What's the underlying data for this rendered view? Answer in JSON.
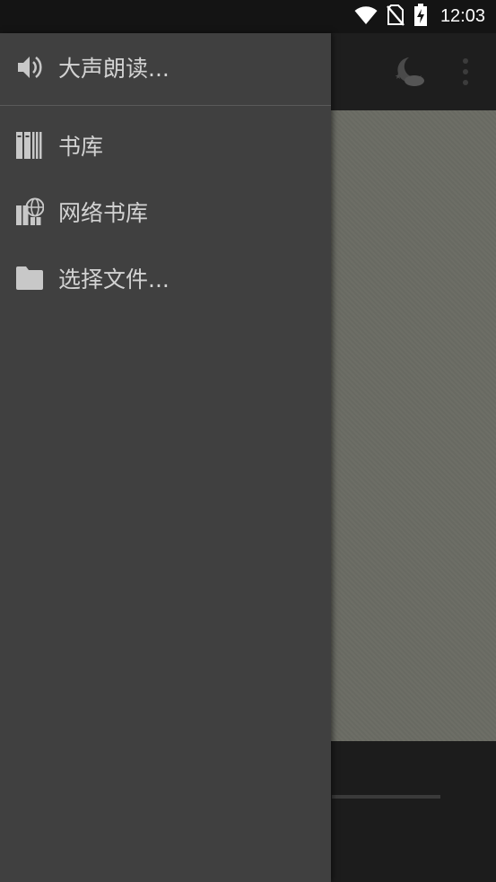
{
  "status_bar": {
    "time": "12:03",
    "icons": [
      "wifi-icon",
      "no-sim-icon",
      "battery-charging-icon"
    ]
  },
  "toolbar": {
    "icons": [
      "night-mode-icon",
      "more-options-icon"
    ]
  },
  "drawer": {
    "top_item": {
      "label": "大声朗读...",
      "icon": "speaker-icon"
    },
    "items": [
      {
        "label": "书库",
        "icon": "library-icon"
      },
      {
        "label": "网络书库",
        "icon": "network-library-icon"
      },
      {
        "label": "选择文件...",
        "icon": "folder-icon"
      }
    ]
  },
  "colors": {
    "drawer_bg": "#404040",
    "page_bg": "#6b6c64",
    "toolbar_bg": "#1e1e1e",
    "text": "#d2d2d2",
    "icon": "#c8c8c8"
  }
}
